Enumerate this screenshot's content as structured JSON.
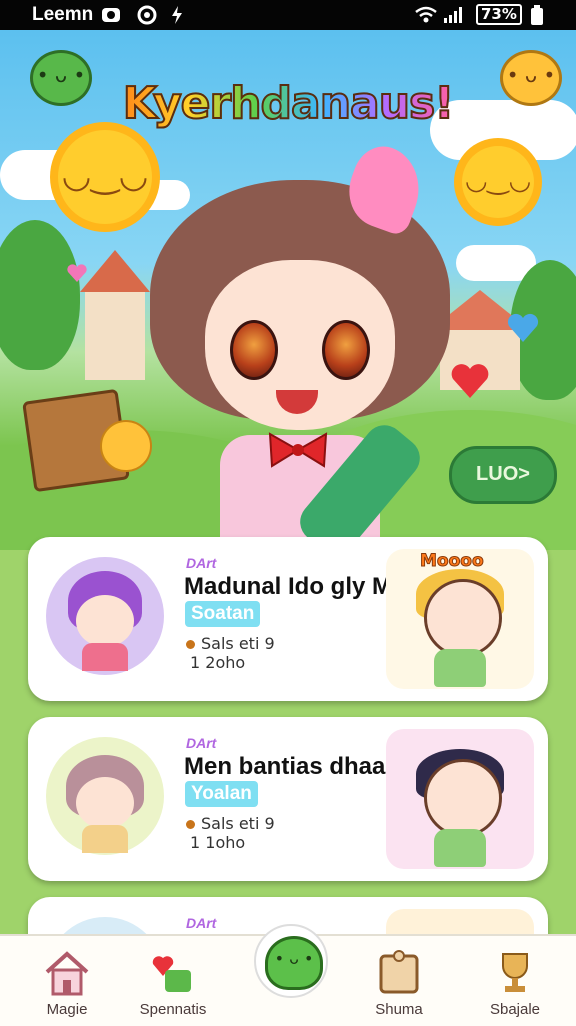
{
  "status_bar": {
    "carrier": "Leemn",
    "battery_text": "73%"
  },
  "app": {
    "title": "Kyerhdanaus!"
  },
  "hero": {
    "action_button_label": "LUO>"
  },
  "cards": [
    {
      "tag": "DArt",
      "name": "Madunal Ido gly MM",
      "pill": "Soatan",
      "meta1": "Sals eti 9",
      "meta2": "1 2oho",
      "art_badge": "Moooo",
      "avatar_color": "#d9c6f3",
      "art_color": "#fff8e6"
    },
    {
      "tag": "DArt",
      "name": "Men bantias dhaab",
      "pill": "Yoalan",
      "meta1": "Sals eti 9",
      "meta2": "1 1oho",
      "art_badge": "",
      "avatar_color": "#ecf4c9",
      "art_color": "#fbe3f1"
    },
    {
      "tag": "DArt",
      "name": "",
      "pill": "",
      "meta1": "",
      "meta2": "",
      "art_badge": "",
      "avatar_color": "#d8ecf7",
      "art_color": "#fff2d9"
    }
  ],
  "nav": [
    {
      "label": "Magie",
      "icon": "house-icon"
    },
    {
      "label": "Spennatis",
      "icon": "heart-icon"
    },
    {
      "label": "",
      "icon": "mascot-icon"
    },
    {
      "label": "Shuma",
      "icon": "puzzle-icon"
    },
    {
      "label": "Sbajale",
      "icon": "trophy-icon"
    }
  ],
  "colors": {
    "accent": "#3f9e4c",
    "sky": "#5cc0ef",
    "grass": "#86cc57",
    "card_bg": "#ffffff"
  }
}
